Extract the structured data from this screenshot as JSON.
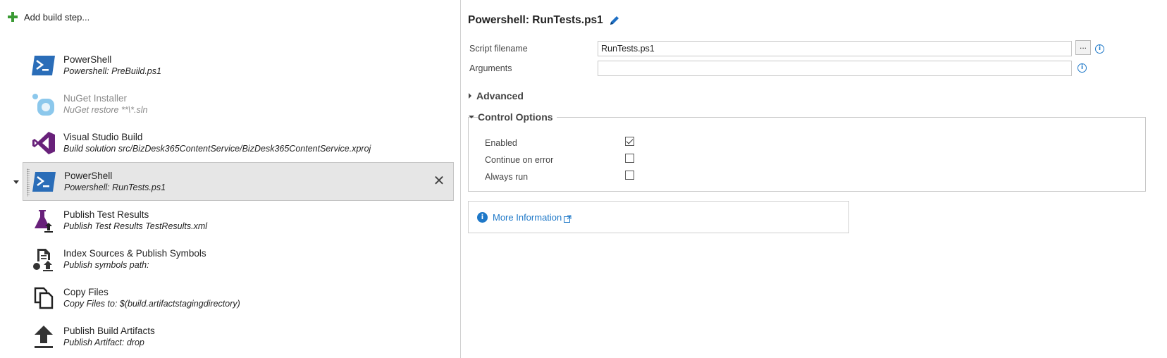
{
  "left": {
    "add_step_label": "Add build step...",
    "steps": [
      {
        "name": "PowerShell",
        "desc": "Powershell: PreBuild.ps1"
      },
      {
        "name": "NuGet Installer",
        "desc": "NuGet restore **\\*.sln"
      },
      {
        "name": "Visual Studio Build",
        "desc": "Build solution src/BizDesk365ContentService/BizDesk365ContentService.xproj"
      },
      {
        "name": "PowerShell",
        "desc": "Powershell: RunTests.ps1"
      },
      {
        "name": "Publish Test Results",
        "desc": "Publish Test Results TestResults.xml"
      },
      {
        "name": "Index Sources & Publish Symbols",
        "desc": "Publish symbols path:"
      },
      {
        "name": "Copy Files",
        "desc": "Copy Files to: $(build.artifactstagingdirectory)"
      },
      {
        "name": "Publish Build Artifacts",
        "desc": "Publish Artifact: drop"
      }
    ],
    "remove_glyph": "✕"
  },
  "right": {
    "title": "Powershell: RunTests.ps1",
    "script_filename_label": "Script filename",
    "script_filename_value": "RunTests.ps1",
    "arguments_label": "Arguments",
    "arguments_value": "",
    "browse_label": "...",
    "advanced_label": "Advanced",
    "control_options_label": "Control Options",
    "options": [
      {
        "label": "Enabled",
        "checked": true
      },
      {
        "label": "Continue on error",
        "checked": false
      },
      {
        "label": "Always run",
        "checked": false
      }
    ],
    "more_info_label": "More Information",
    "info_glyph": "i"
  },
  "colors": {
    "accent_blue": "#1e78c8",
    "powershell_blue": "#2a6db8",
    "vs_purple": "#68217a",
    "add_green": "#3a9a34",
    "selected_bg": "#e6e6e6"
  }
}
